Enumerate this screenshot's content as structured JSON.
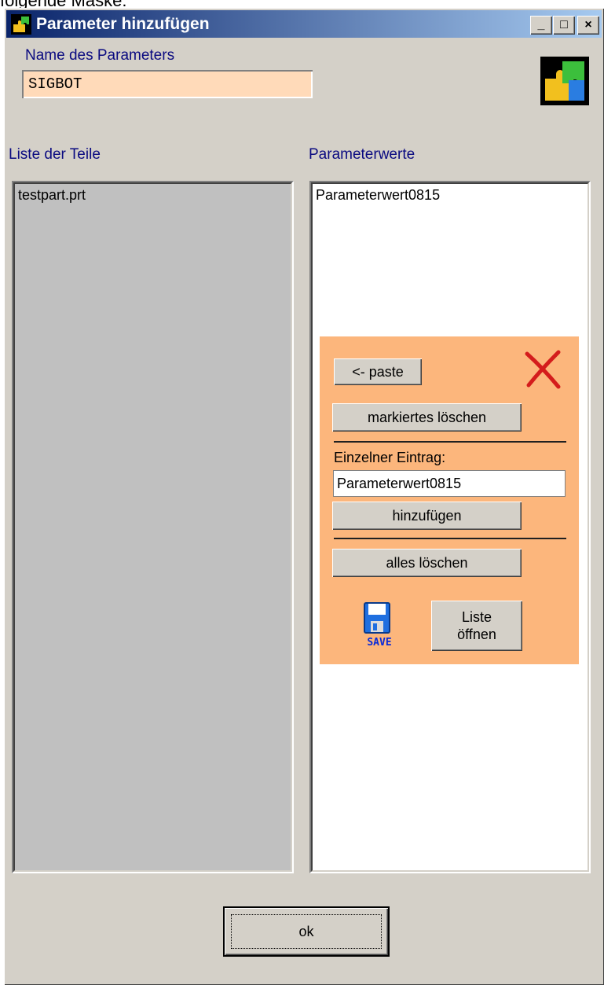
{
  "caption": "folgende Maske:",
  "window": {
    "title": "Parameter hinzufügen",
    "minimize": "_",
    "maximize": "□",
    "close": "×"
  },
  "name_field": {
    "label": "Name des Parameters",
    "value": "SIGBOT"
  },
  "parts_list": {
    "label": "Liste der Teile",
    "items": [
      "testpart.prt"
    ]
  },
  "values_list": {
    "label": "Parameterwerte",
    "items": [
      "Parameterwert0815"
    ]
  },
  "panel": {
    "paste_label": "<- paste",
    "delete_selected_label": "markiertes löschen",
    "single_entry_label": "Einzelner Eintrag:",
    "single_entry_value": "Parameterwert0815",
    "add_label": "hinzufügen",
    "delete_all_label": "alles löschen",
    "save_icon_text": "SAVE",
    "open_list_label_line1": "Liste",
    "open_list_label_line2": "öffnen"
  },
  "ok_label": "ok",
  "colors": {
    "panel": "#fcb67c",
    "name_field_bg": "#ffdab9",
    "dialog_bg": "#d4d0c8",
    "close_x": "#d41c1c"
  },
  "icons": [
    "puzzle-icon",
    "close-x-icon",
    "save-disk-icon"
  ]
}
